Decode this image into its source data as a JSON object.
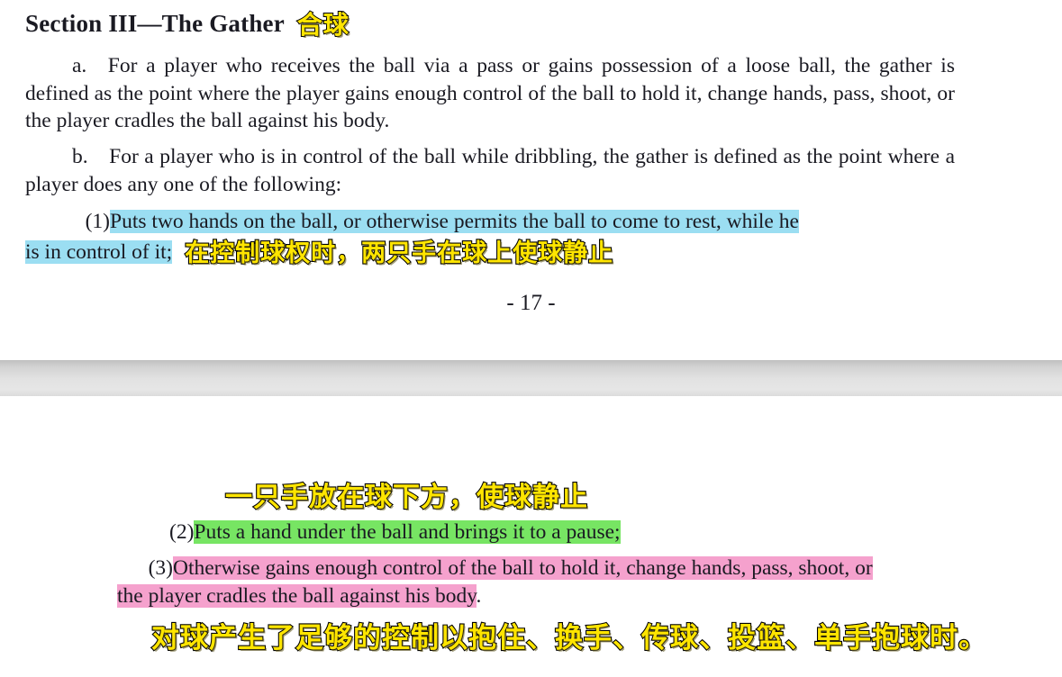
{
  "document": {
    "heading": {
      "english": "Section III—The Gather",
      "chinese_annotation": "合球"
    },
    "page_one": {
      "paragraph_a": "a. For a player who receives the ball via a pass or gains possession of a loose ball, the gather is defined as the point where the player gains enough control of the ball to hold it, change hands, pass, shoot, or the player cradles the ball against his body.",
      "paragraph_b": "b. For a player who is in control of the ball while dribbling, the gather is defined as the point where a player does any one of the following:",
      "item_1": {
        "marker": "(1)",
        "text_line_1": "Puts two hands on the ball, or otherwise permits the ball to come to rest, while he",
        "text_line_2": "is in control of it;",
        "highlight_color": "#9BDEF2",
        "chinese_annotation": "在控制球权时，两只手在球上使球静止"
      },
      "page_number": "- 17 -"
    },
    "page_two": {
      "annotation_above_item_2": "一只手放在球下方，使球静止",
      "item_2": {
        "marker": "(2)",
        "text": "Puts a hand under the ball and brings it to a pause;",
        "highlight_color": "#77E563"
      },
      "item_3": {
        "marker": "(3)",
        "text_line_1": "Otherwise gains enough control of the ball to hold it, change hands, pass, shoot, or",
        "text_line_2": "the player cradles the ball against his body",
        "trailing_punctuation": ".",
        "highlight_color": "#F5A1CD"
      },
      "annotation_bottom": "对球产生了足够的控制以抱住、换手、传球、投篮、单手抱球时。"
    },
    "colors": {
      "highlight_blue": "#9BDEF2",
      "highlight_green": "#77E563",
      "highlight_pink": "#F5A1CD",
      "annotation_yellow": "#FFE500",
      "annotation_outline": "#000000",
      "text": "#1a1a22",
      "separator_gray": "#d8d8d8"
    }
  }
}
